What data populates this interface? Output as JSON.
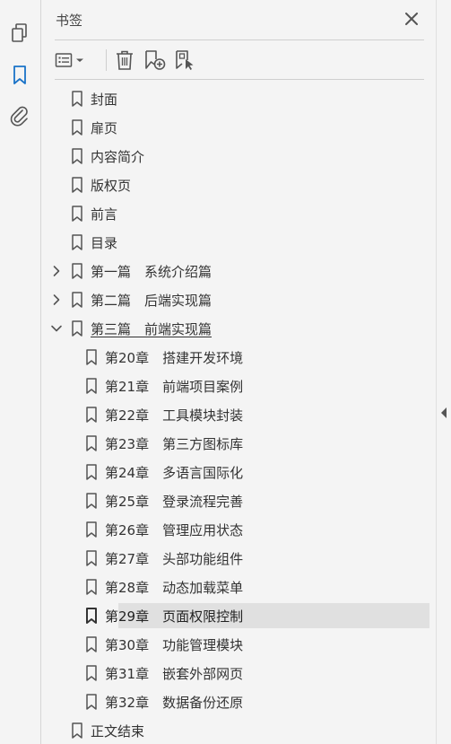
{
  "panel": {
    "title": "书签"
  },
  "icons": {
    "rail": [
      "pages-icon",
      "bookmark-icon",
      "attachment-icon"
    ],
    "toolbar": [
      "options-menu-icon",
      "delete-icon",
      "new-bookmark-icon",
      "new-bookmark-from-structure-icon"
    ],
    "close": "close-icon"
  },
  "colors": {
    "accent": "#1a73c8",
    "selected_bg": "#e0e0e0",
    "icon": "#555555"
  },
  "bookmarks": [
    {
      "label": "封面",
      "level": 0,
      "expander": "none"
    },
    {
      "label": "扉页",
      "level": 0,
      "expander": "none"
    },
    {
      "label": "内容简介",
      "level": 0,
      "expander": "none"
    },
    {
      "label": "版权页",
      "level": 0,
      "expander": "none"
    },
    {
      "label": "前言",
      "level": 0,
      "expander": "none"
    },
    {
      "label": "目录",
      "level": 0,
      "expander": "none"
    },
    {
      "label": "第一篇　系统介绍篇",
      "level": 0,
      "expander": "collapsed"
    },
    {
      "label": "第二篇　后端实现篇",
      "level": 0,
      "expander": "collapsed"
    },
    {
      "label": "第三篇　前端实现篇",
      "level": 0,
      "expander": "expanded",
      "underlined": true
    },
    {
      "label": "第20章　搭建开发环境",
      "level": 1,
      "expander": "none"
    },
    {
      "label": "第21章　前端项目案例",
      "level": 1,
      "expander": "none"
    },
    {
      "label": "第22章　工具模块封装",
      "level": 1,
      "expander": "none"
    },
    {
      "label": "第23章　第三方图标库",
      "level": 1,
      "expander": "none"
    },
    {
      "label": "第24章　多语言国际化",
      "level": 1,
      "expander": "none"
    },
    {
      "label": "第25章　登录流程完善",
      "level": 1,
      "expander": "none"
    },
    {
      "label": "第26章　管理应用状态",
      "level": 1,
      "expander": "none"
    },
    {
      "label": "第27章　头部功能组件",
      "level": 1,
      "expander": "none"
    },
    {
      "label": "第28章　动态加载菜单",
      "level": 1,
      "expander": "none"
    },
    {
      "label": "第29章　页面权限控制",
      "level": 1,
      "expander": "none",
      "selected": true
    },
    {
      "label": "第30章　功能管理模块",
      "level": 1,
      "expander": "none"
    },
    {
      "label": "第31章　嵌套外部网页",
      "level": 1,
      "expander": "none"
    },
    {
      "label": "第32章　数据备份还原",
      "level": 1,
      "expander": "none"
    },
    {
      "label": "正文结束",
      "level": 0,
      "expander": "none"
    }
  ]
}
